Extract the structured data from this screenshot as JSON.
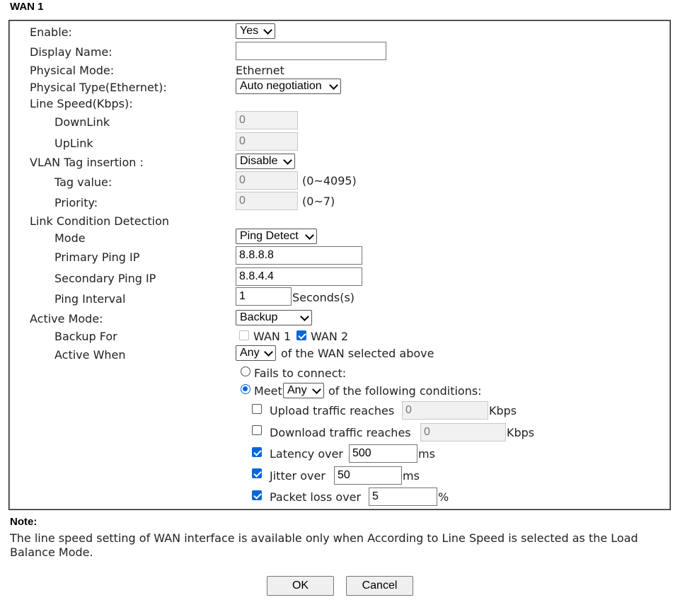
{
  "section_title": "WAN 1",
  "fields": {
    "enable": {
      "label": "Enable:",
      "value": "Yes"
    },
    "display_name": {
      "label": "Display Name:",
      "value": ""
    },
    "physical_mode": {
      "label": "Physical Mode:",
      "value": "Ethernet"
    },
    "physical_type": {
      "label": "Physical Type(Ethernet):",
      "value": "Auto negotiation"
    },
    "line_speed": {
      "label": "Line Speed(Kbps):"
    },
    "downlink": {
      "label": "DownLink",
      "value": "0"
    },
    "uplink": {
      "label": "UpLink",
      "value": "0"
    },
    "vlan_tag_insertion": {
      "label": "VLAN Tag insertion :",
      "value": "Disable"
    },
    "tag_value": {
      "label": "Tag value:",
      "value": "0",
      "range": "(0~4095)"
    },
    "priority": {
      "label": "Priority:",
      "value": "0",
      "range": "(0~7)"
    },
    "link_condition_detection": {
      "label": "Link Condition Detection"
    },
    "mode": {
      "label": "Mode",
      "value": "Ping Detect"
    },
    "primary_ping_ip": {
      "label": "Primary Ping IP",
      "value": "8.8.8.8"
    },
    "secondary_ping_ip": {
      "label": "Secondary Ping IP",
      "value": "8.8.4.4"
    },
    "ping_interval": {
      "label": "Ping Interval",
      "value": "1",
      "unit": "Seconds(s)"
    },
    "active_mode": {
      "label": "Active Mode:",
      "value": "Backup"
    },
    "backup_for": {
      "label": "Backup For",
      "wan1_label": "WAN 1",
      "wan1_checked": false,
      "wan1_disabled": true,
      "wan2_label": "WAN 2",
      "wan2_checked": true
    },
    "active_when": {
      "label": "Active When",
      "value": "Any",
      "suffix": "of the WAN selected above"
    }
  },
  "conditions": {
    "fails_to_connect": {
      "label": "Fails to connect:",
      "selected": false
    },
    "meet": {
      "label": "Meet",
      "select_value": "Any",
      "suffix": "of the following conditions:",
      "selected": true
    },
    "items": {
      "upload": {
        "label": "Upload traffic reaches",
        "value": "0",
        "unit": "Kbps",
        "checked": false
      },
      "download": {
        "label": "Download traffic reaches",
        "value": "0",
        "unit": "Kbps",
        "checked": false
      },
      "latency": {
        "label": "Latency over",
        "value": "500",
        "unit": "ms",
        "checked": true
      },
      "jitter": {
        "label": "Jitter over",
        "value": "50",
        "unit": "ms",
        "checked": true
      },
      "packet_loss": {
        "label": "Packet loss over",
        "value": "5",
        "unit": "%",
        "checked": true
      }
    }
  },
  "note": {
    "title": "Note:",
    "text": "The line speed setting of WAN interface is available only when According to Line Speed is selected as the Load Balance Mode."
  },
  "buttons": {
    "ok": "OK",
    "cancel": "Cancel"
  },
  "colors": {
    "accent": "#0a66d8",
    "border": "#222222"
  }
}
